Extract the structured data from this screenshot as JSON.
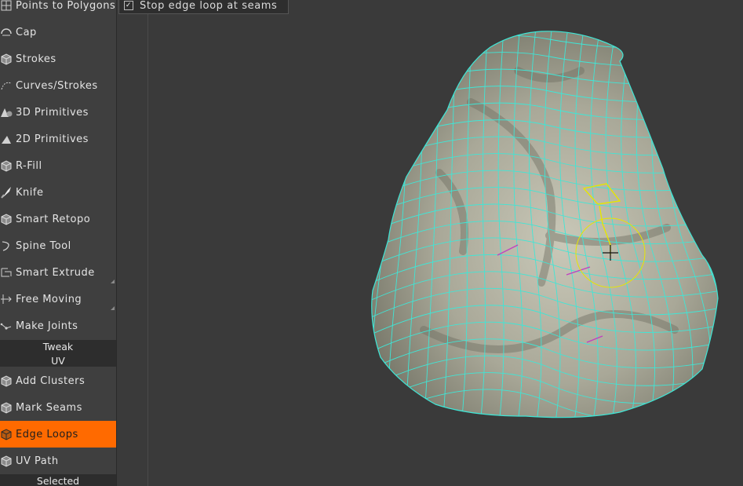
{
  "tools": [
    {
      "label": "Points to Polygons",
      "icon": "polygon-grid-icon",
      "active": false
    },
    {
      "label": "Cap",
      "icon": "cap-icon",
      "active": false
    },
    {
      "label": "Strokes",
      "icon": "cube-grid-icon",
      "active": false
    },
    {
      "label": "Curves/Strokes",
      "icon": "curve-dots-icon",
      "active": false
    },
    {
      "label": "3D Primitives",
      "icon": "primitives-3d-icon",
      "active": false
    },
    {
      "label": "2D Primitives",
      "icon": "primitives-2d-icon",
      "active": false
    },
    {
      "label": "R-Fill",
      "icon": "cube-grid-icon",
      "active": false
    },
    {
      "label": "Knife",
      "icon": "knife-icon",
      "active": false
    },
    {
      "label": "Smart Retopo",
      "icon": "cube-grid-icon",
      "active": false
    },
    {
      "label": "Spine Tool",
      "icon": "spine-icon",
      "active": false
    },
    {
      "label": "Smart Extrude",
      "icon": "extrude-icon",
      "active": false
    },
    {
      "label": "Free Moving",
      "icon": "move-arrows-icon",
      "active": false
    },
    {
      "label": "Make Joints",
      "icon": "joints-icon",
      "active": false
    }
  ],
  "section_tweak": "Tweak",
  "section_uv": "UV",
  "uv_tools": [
    {
      "label": "Add Clusters",
      "icon": "cube-grid-icon",
      "active": false
    },
    {
      "label": "Mark Seams",
      "icon": "cube-grid-icon",
      "active": false
    },
    {
      "label": "Edge Loops",
      "icon": "cube-grid-icon",
      "active": true
    },
    {
      "label": "UV Path",
      "icon": "cube-grid-icon",
      "active": false
    }
  ],
  "section_selected": "Selected",
  "options": {
    "stop_edge_loop_label": "Stop edge loop at seams",
    "stop_edge_loop_checked": true
  },
  "colors": {
    "accent": "#ff6a00",
    "wireframe": "#3fe6d6",
    "selection": "#e6e600",
    "seam": "#c040c0"
  }
}
